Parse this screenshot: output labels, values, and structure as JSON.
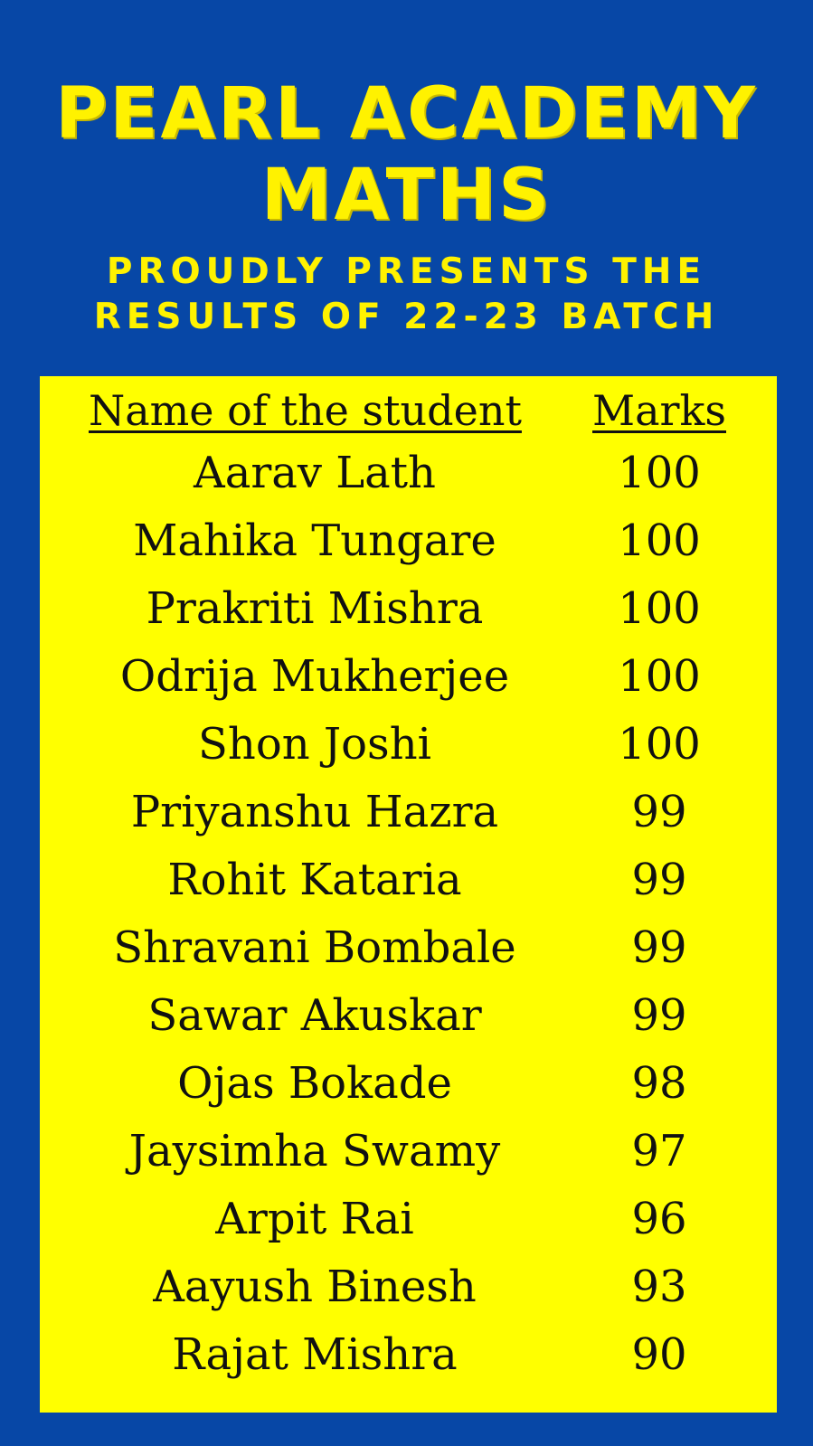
{
  "header": {
    "title_line1": "PEARL ACADEMY",
    "title_line2": "MATHS",
    "subtitle_line1": "PROUDLY PRESENTS THE",
    "subtitle_line2": "RESULTS OF 22-23 BATCH"
  },
  "table": {
    "columns": [
      "Name of the student",
      "Marks"
    ],
    "rows": [
      {
        "name": "Aarav Lath",
        "marks": "100"
      },
      {
        "name": "Mahika Tungare",
        "marks": "100"
      },
      {
        "name": "Prakriti Mishra",
        "marks": "100"
      },
      {
        "name": "Odrija Mukherjee",
        "marks": "100"
      },
      {
        "name": "Shon Joshi",
        "marks": "100"
      },
      {
        "name": "Priyanshu Hazra",
        "marks": "99"
      },
      {
        "name": "Rohit Kataria",
        "marks": "99"
      },
      {
        "name": "Shravani Bombale",
        "marks": "99"
      },
      {
        "name": "Sawar Akuskar",
        "marks": "99"
      },
      {
        "name": "Ojas Bokade",
        "marks": "98"
      },
      {
        "name": "Jaysimha Swamy",
        "marks": "97"
      },
      {
        "name": "Arpit Rai",
        "marks": "96"
      },
      {
        "name": "Aayush Binesh",
        "marks": "93"
      },
      {
        "name": "Rajat Mishra",
        "marks": "90"
      }
    ]
  },
  "colors": {
    "background": "#0747a6",
    "title_text": "#fff200",
    "panel": "#ffff00",
    "table_text": "#111111"
  }
}
